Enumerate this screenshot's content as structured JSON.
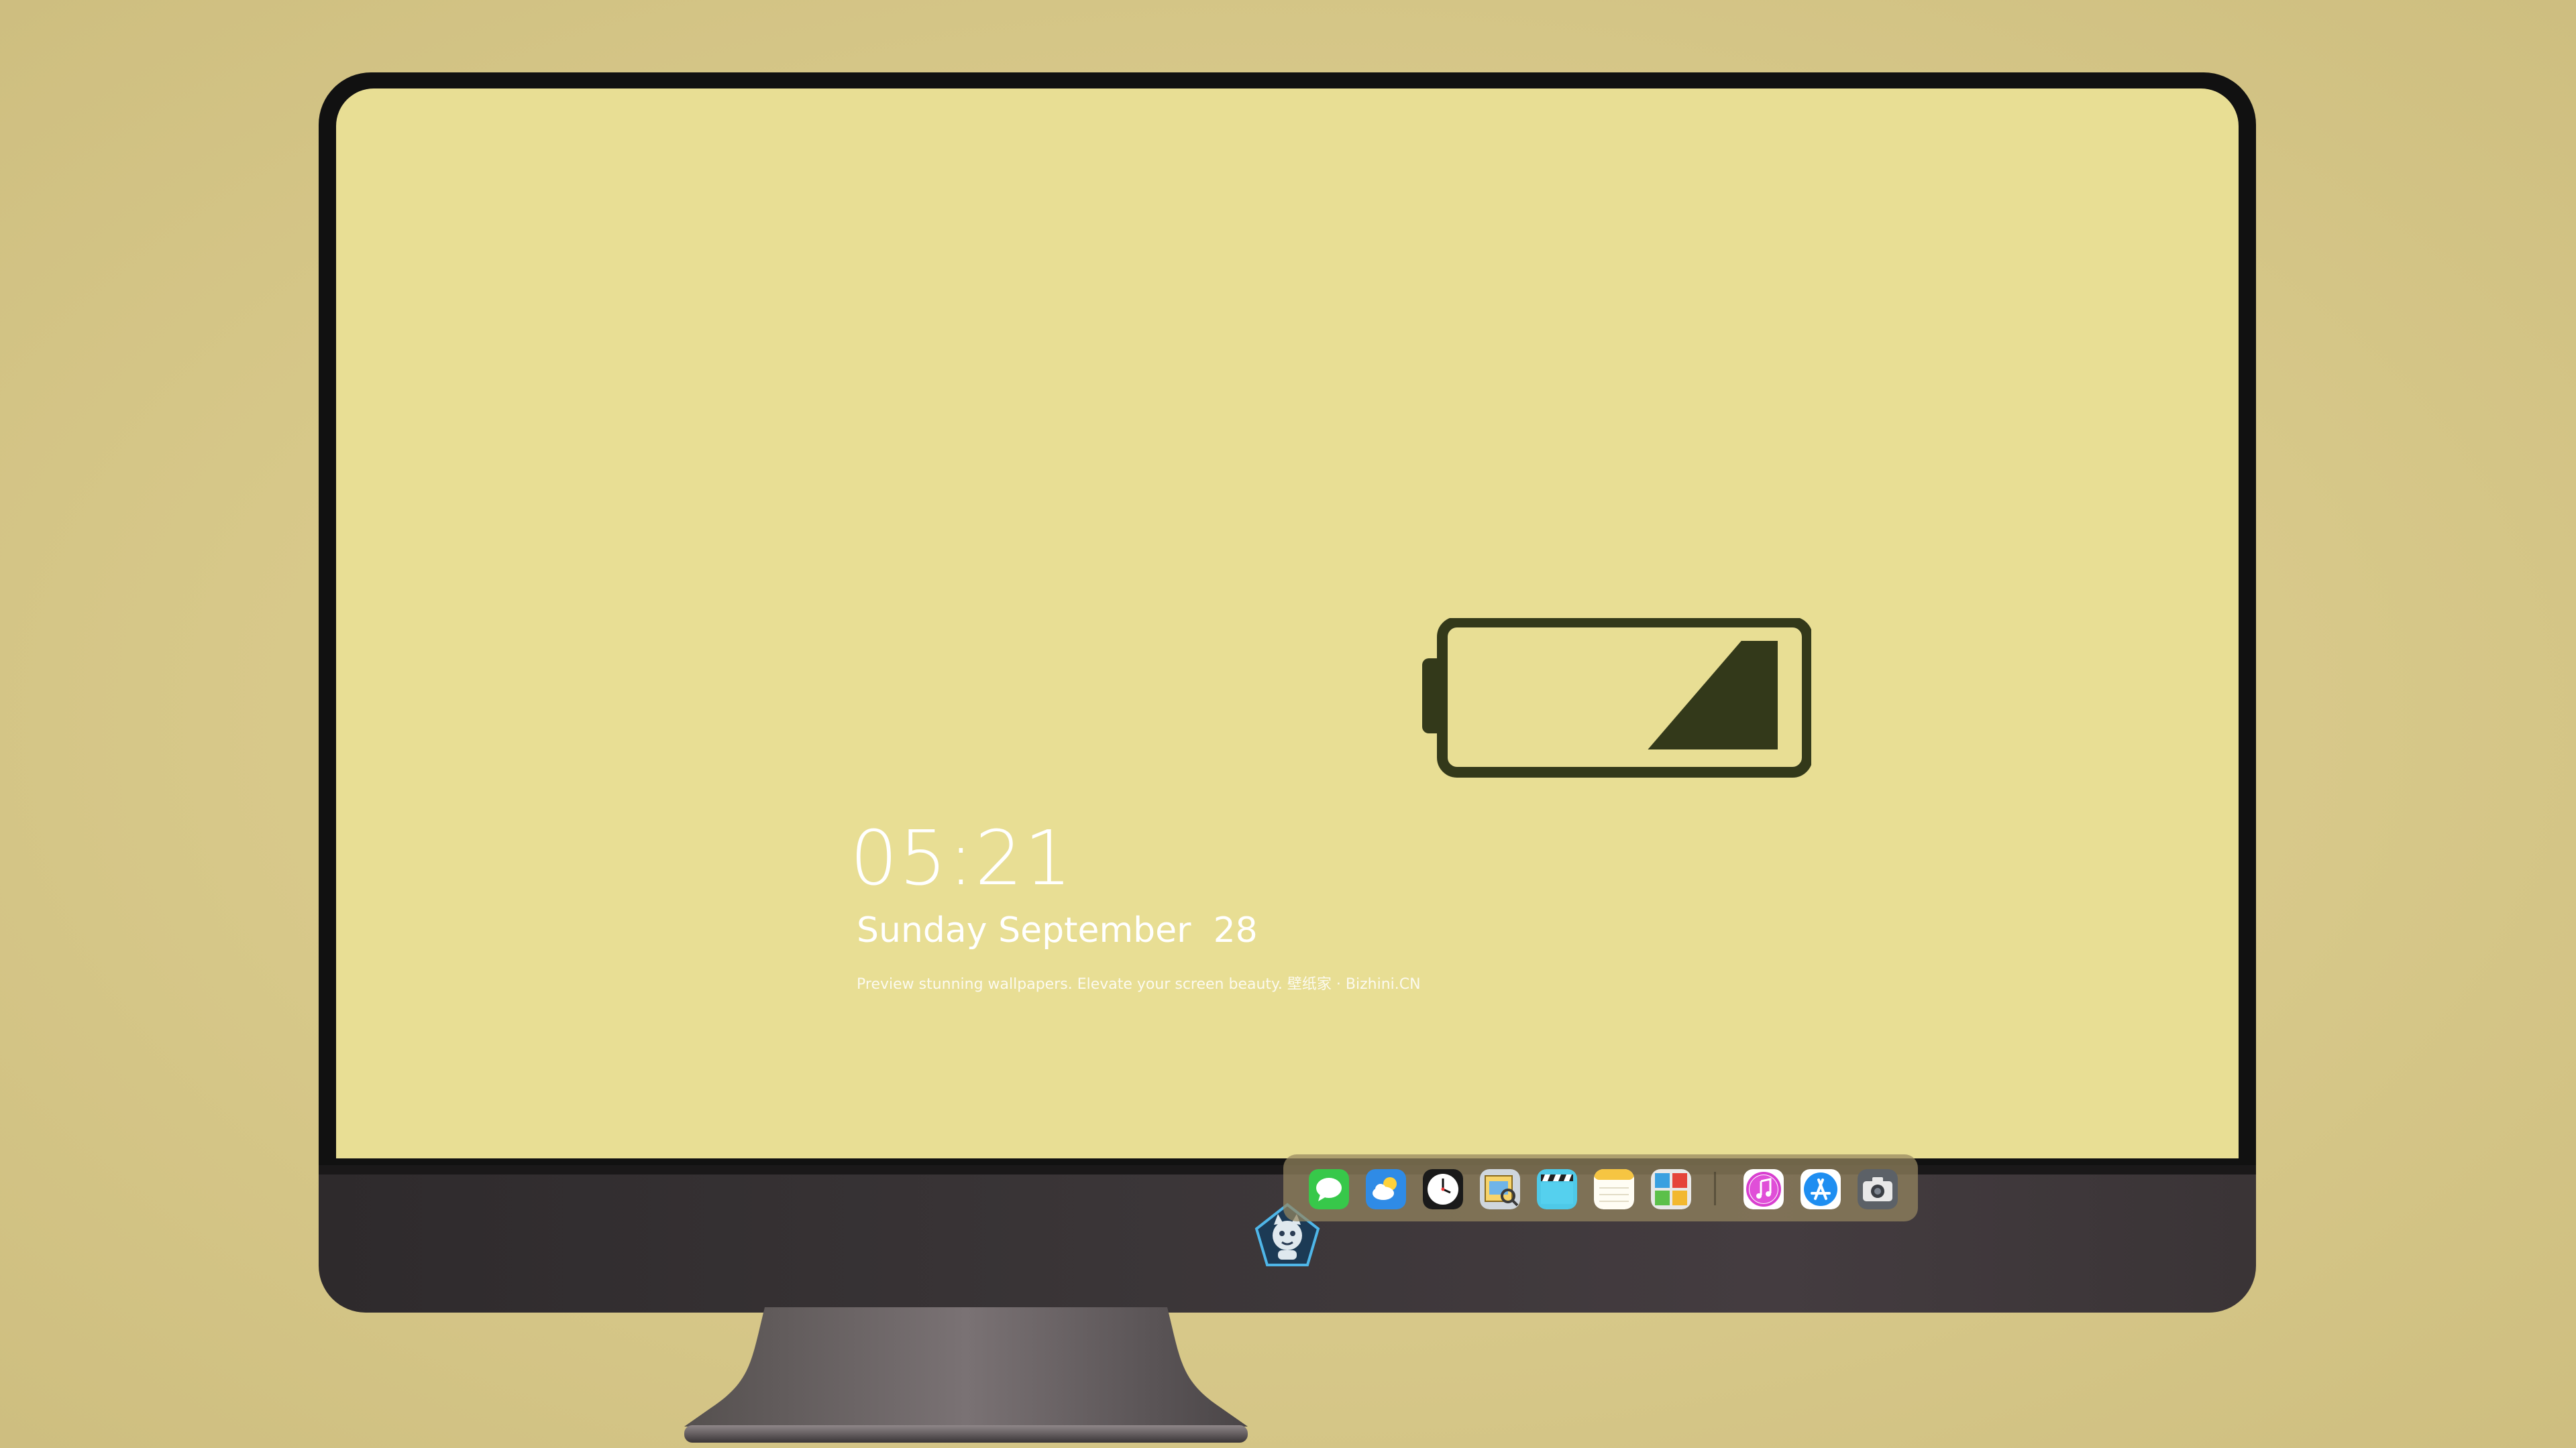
{
  "lockscreen": {
    "time": "05:21",
    "date": "Sunday September  28",
    "tagline": "Preview stunning wallpapers. Elevate your screen beauty. 壁纸家 · Bizhini.CN"
  },
  "battery": {
    "icon": "battery-low-icon",
    "level": 0.4,
    "color": "#33391a"
  },
  "dock": {
    "apps": [
      {
        "name": "messages",
        "icon": "messages-icon"
      },
      {
        "name": "weather",
        "icon": "weather-icon"
      },
      {
        "name": "clock",
        "icon": "clock-icon"
      },
      {
        "name": "preview",
        "icon": "preview-icon"
      },
      {
        "name": "clips",
        "icon": "clapperboard-icon"
      },
      {
        "name": "notes",
        "icon": "notes-icon"
      },
      {
        "name": "photo-booth",
        "icon": "photo-booth-icon"
      },
      {
        "name": "itunes",
        "icon": "music-note-icon"
      },
      {
        "name": "app-store",
        "icon": "app-store-icon"
      },
      {
        "name": "camera",
        "icon": "camera-icon"
      }
    ]
  },
  "colors": {
    "background": "#d8c98a",
    "screen": "#e8de94",
    "bezel": "#111111",
    "chin": "#3a3537"
  }
}
